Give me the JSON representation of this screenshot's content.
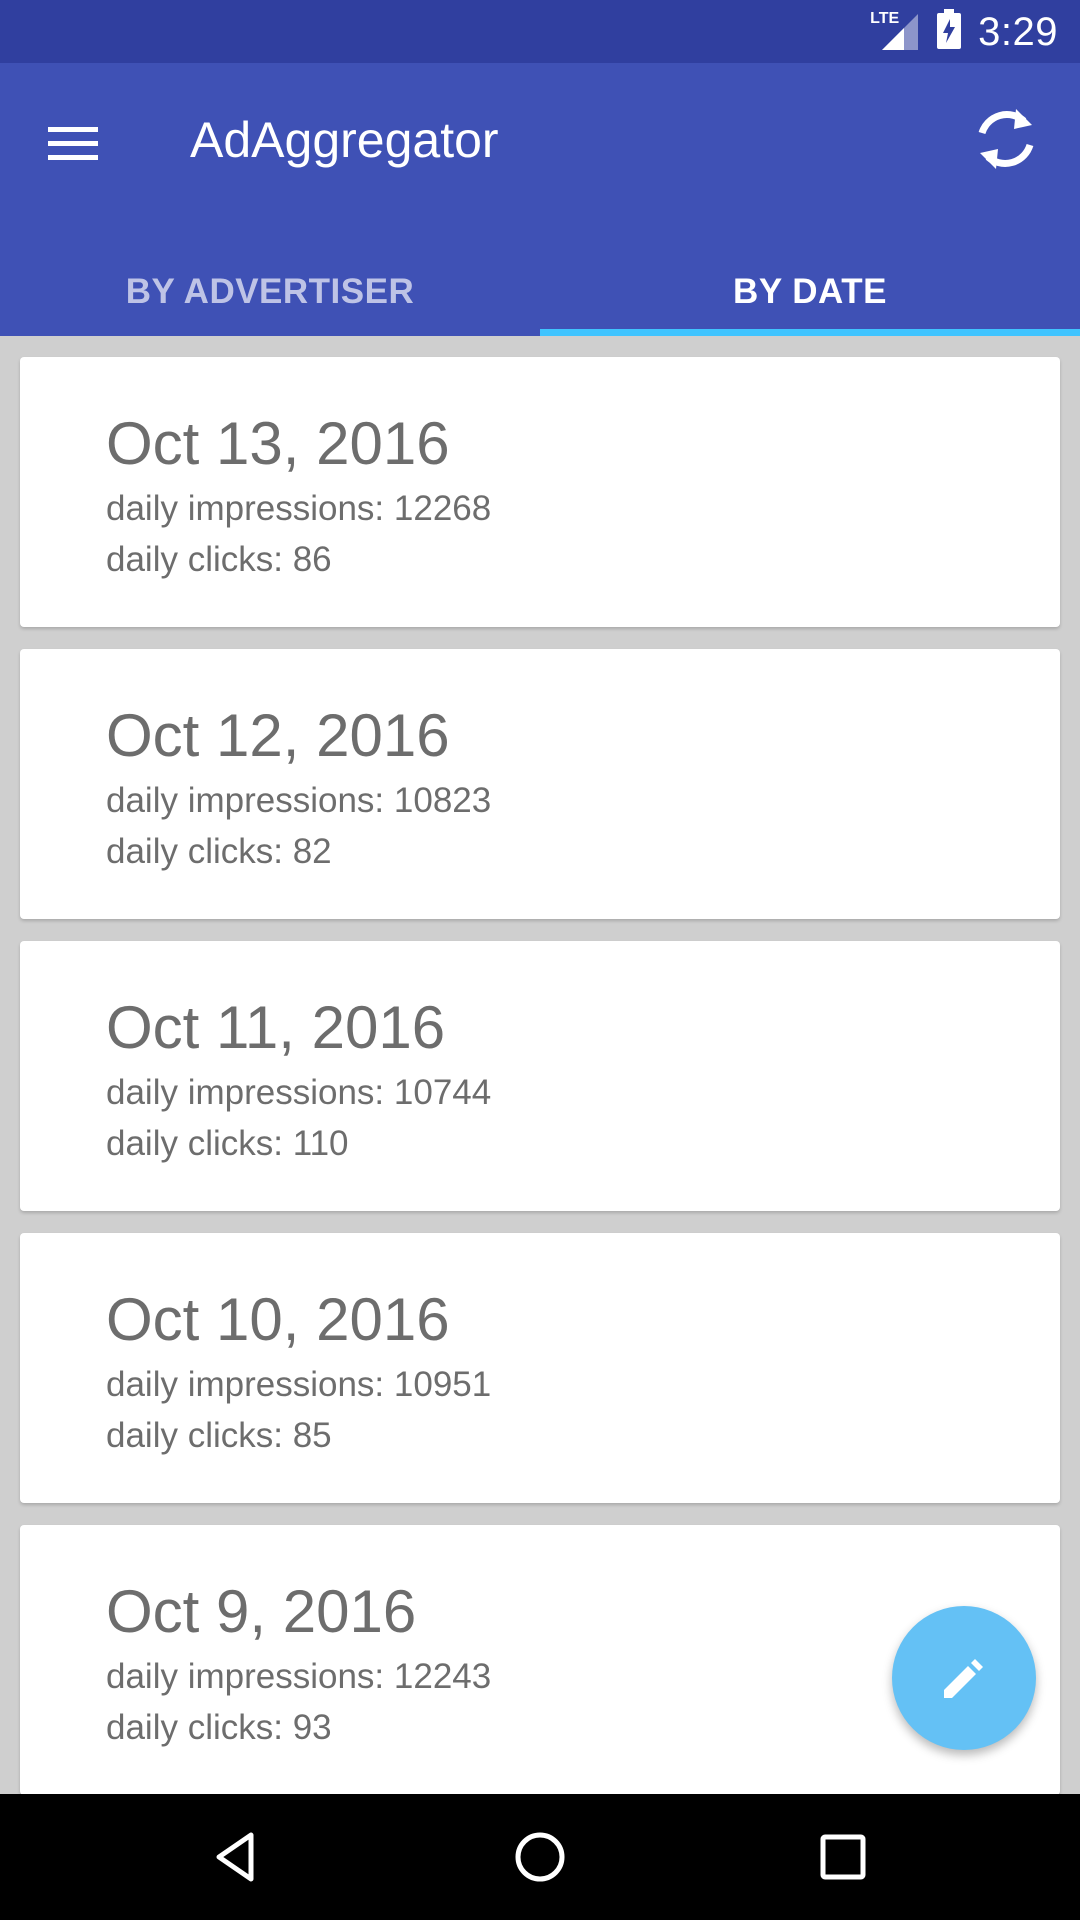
{
  "status_bar": {
    "network": "LTE",
    "time": "3:29",
    "signal_icon": "cell-signal-icon",
    "battery_icon": "battery-charging-icon"
  },
  "app_bar": {
    "title": "AdAggregator",
    "menu_icon": "hamburger-menu-icon",
    "refresh_icon": "refresh-icon",
    "background": "#3f51b5"
  },
  "tabs": [
    {
      "label": "BY ADVERTISER",
      "selected": false
    },
    {
      "label": "BY DATE",
      "selected": true
    }
  ],
  "cards": [
    {
      "date": "Oct 13, 2016",
      "impressions_label": "daily impressions: ",
      "impressions": "12268",
      "clicks_label": "daily clicks: ",
      "clicks": "86"
    },
    {
      "date": "Oct 12, 2016",
      "impressions_label": "daily impressions: ",
      "impressions": "10823",
      "clicks_label": "daily clicks: ",
      "clicks": "82"
    },
    {
      "date": "Oct 11, 2016",
      "impressions_label": "daily impressions: ",
      "impressions": "10744",
      "clicks_label": "daily clicks: ",
      "clicks": "110"
    },
    {
      "date": "Oct 10, 2016",
      "impressions_label": "daily impressions: ",
      "impressions": "10951",
      "clicks_label": "daily clicks: ",
      "clicks": "85"
    },
    {
      "date": "Oct 9, 2016",
      "impressions_label": "daily impressions: ",
      "impressions": "12243",
      "clicks_label": "daily clicks: ",
      "clicks": "93"
    }
  ],
  "fab": {
    "icon": "pencil-edit-icon",
    "color": "#64c1f5"
  },
  "nav_bar": {
    "back_icon": "back-triangle-icon",
    "home_icon": "home-circle-icon",
    "recents_icon": "recents-square-icon"
  },
  "colors": {
    "status_bar": "#303f9f",
    "tab_indicator": "#40c4ff",
    "list_background": "#cfcfcf"
  }
}
